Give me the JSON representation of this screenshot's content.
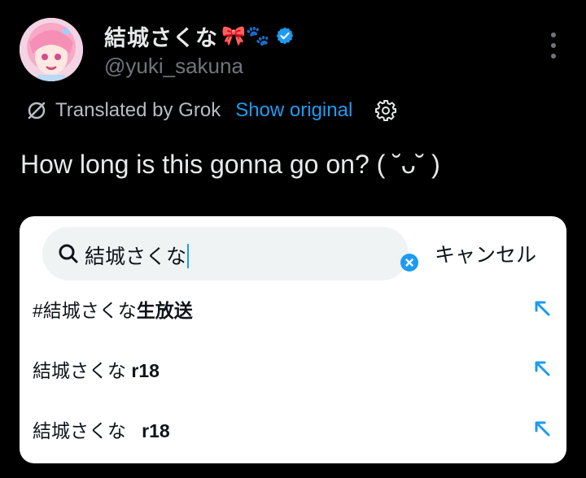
{
  "post": {
    "display_name": "結城さくな",
    "name_emojis": "🎀🐾",
    "handle": "@yuki_sakuna",
    "translated_label": "Translated by Grok",
    "show_original_label": "Show original",
    "text": "How long is this gonna go on? ( ˘ᴗ˘ )"
  },
  "search": {
    "query": "結城さくな",
    "cancel_label": "キャンセル",
    "suggestions": [
      {
        "prefix": "#結城さくな",
        "bold": "生放送"
      },
      {
        "prefix": "結城さくな ",
        "bold": "r18"
      },
      {
        "prefix": "結城さくな   ",
        "bold": "r18"
      }
    ]
  },
  "colors": {
    "background": "#000000",
    "accent": "#1d9bf0",
    "secondary_text": "#71767b",
    "card": "#ffffff",
    "search_field": "#eff3f4"
  },
  "icons": [
    "verified-badge-icon",
    "more-options-icon",
    "translate-icon",
    "gear-icon",
    "search-icon",
    "clear-icon",
    "fill-query-arrow-icon"
  ]
}
